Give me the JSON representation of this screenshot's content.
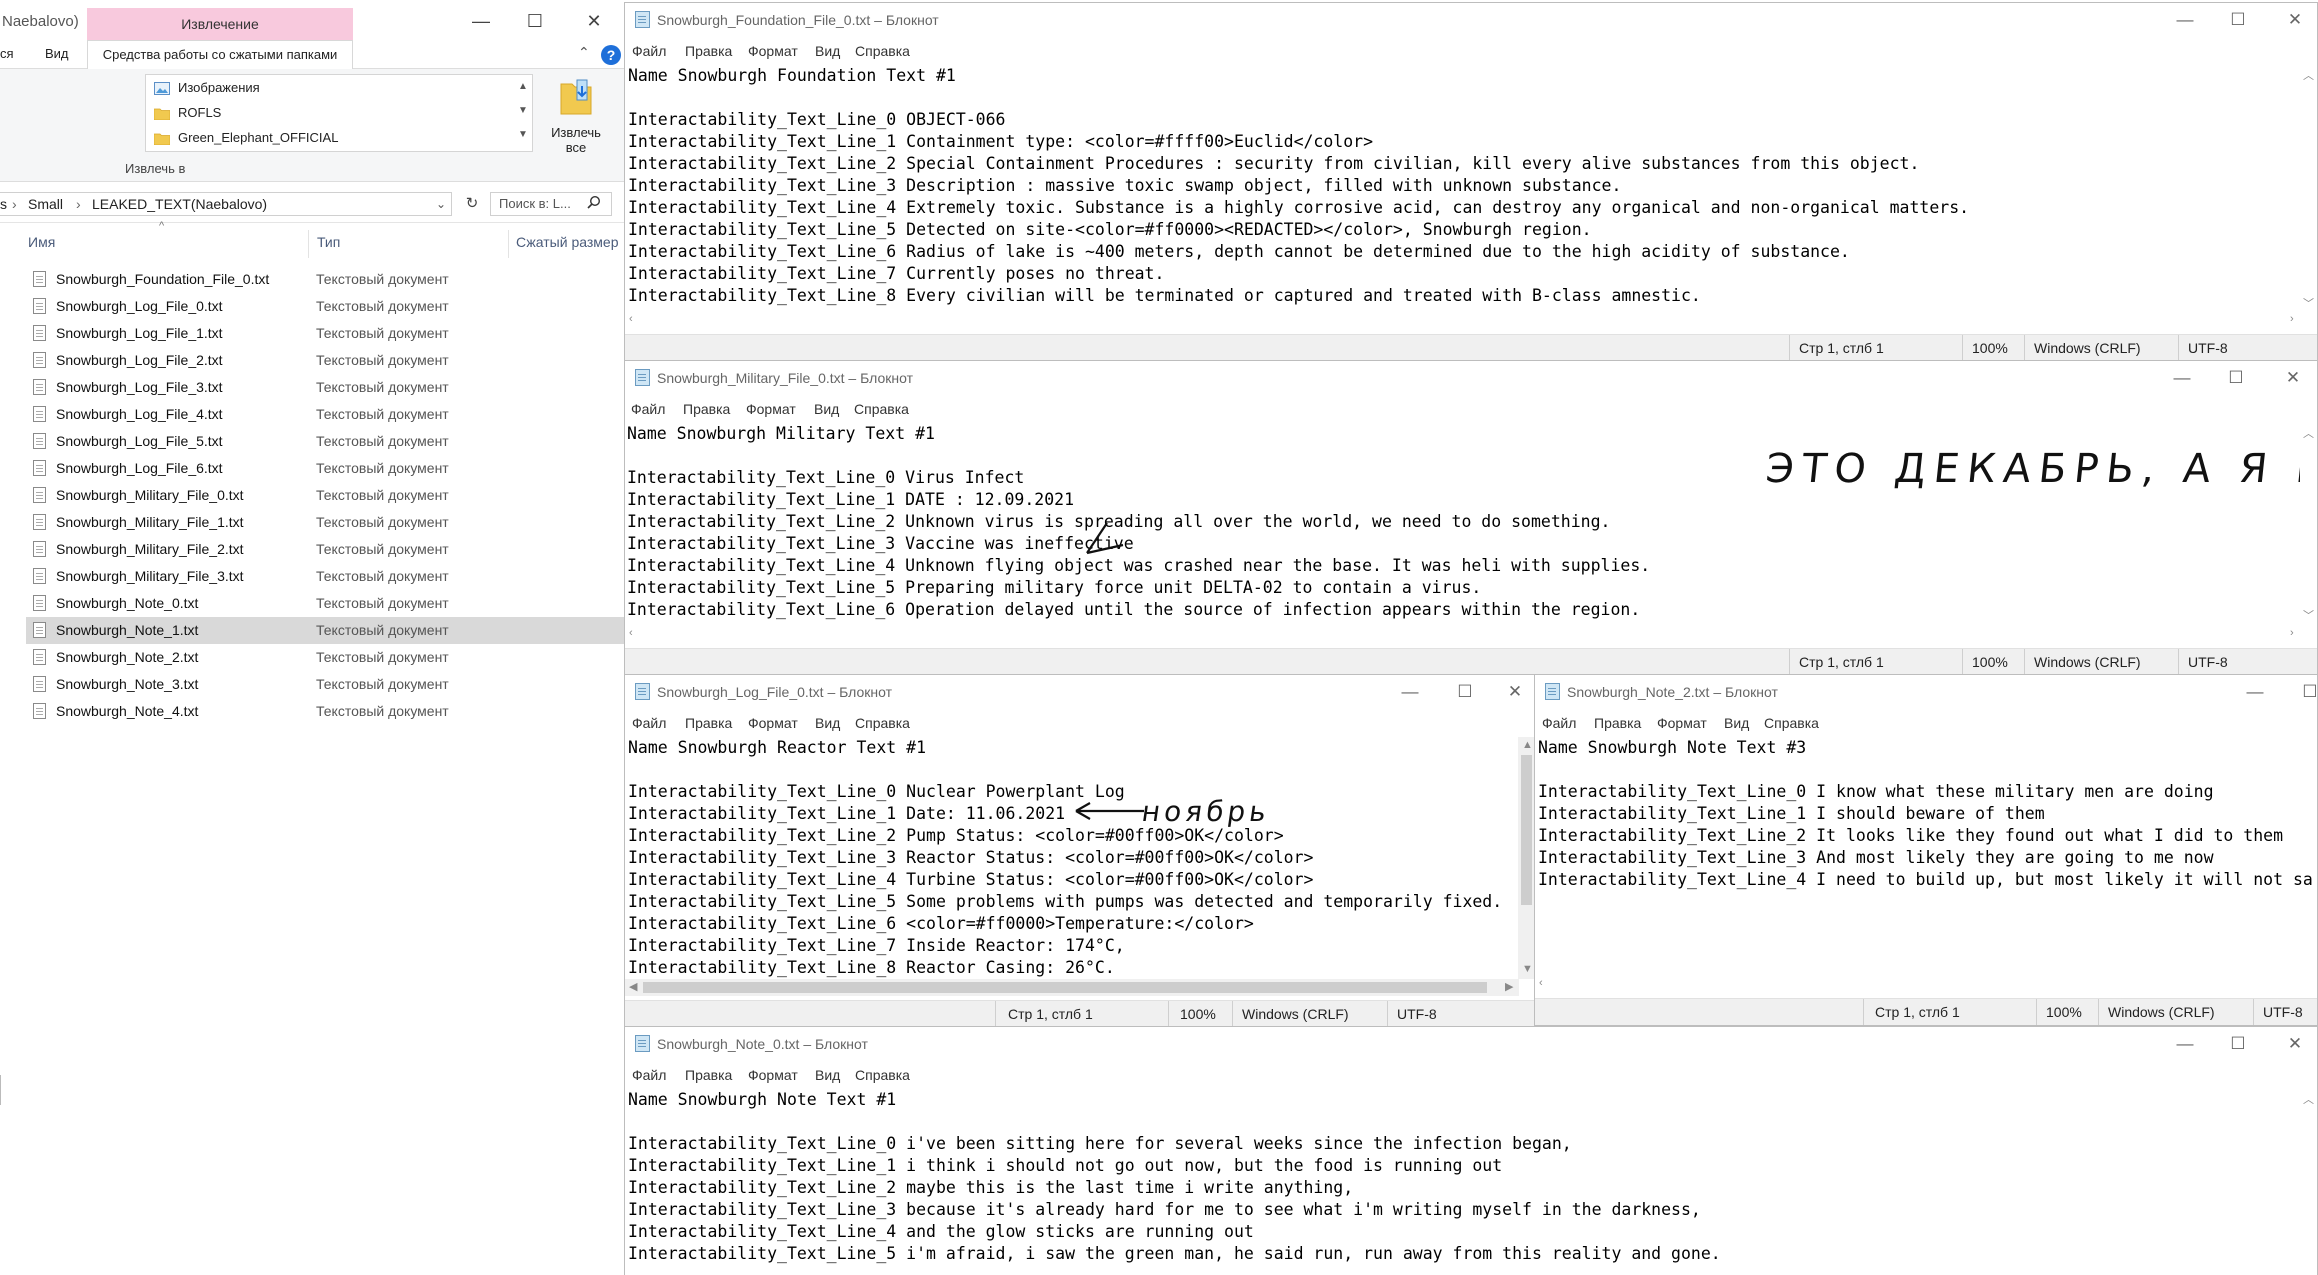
{
  "explorer": {
    "title_fragment": "Naebalovo)",
    "extract_tab": "Извлечение",
    "tabs": [
      "ся",
      "Вид"
    ],
    "active_tab": "Средства работы со сжатыми папками",
    "gallery_items": [
      "Изображения",
      "ROFLS",
      "Green_Elephant_OFFICIAL"
    ],
    "extract_all_label_1": "Извлечь",
    "extract_all_label_2": "все",
    "extract_to_label": "Извлечь в",
    "breadcrumb": [
      "s",
      "Small",
      "LEAKED_TEXT(Naebalovo)"
    ],
    "search_placeholder": "Поиск в: L...",
    "columns": [
      "Имя",
      "Тип",
      "Сжатый размер"
    ],
    "files": [
      {
        "name": "Snowburgh_Foundation_File_0.txt",
        "type": "Текстовый документ"
      },
      {
        "name": "Snowburgh_Log_File_0.txt",
        "type": "Текстовый документ"
      },
      {
        "name": "Snowburgh_Log_File_1.txt",
        "type": "Текстовый документ"
      },
      {
        "name": "Snowburgh_Log_File_2.txt",
        "type": "Текстовый документ"
      },
      {
        "name": "Snowburgh_Log_File_3.txt",
        "type": "Текстовый документ"
      },
      {
        "name": "Snowburgh_Log_File_4.txt",
        "type": "Текстовый документ"
      },
      {
        "name": "Snowburgh_Log_File_5.txt",
        "type": "Текстовый документ"
      },
      {
        "name": "Snowburgh_Log_File_6.txt",
        "type": "Текстовый документ"
      },
      {
        "name": "Snowburgh_Military_File_0.txt",
        "type": "Текстовый документ"
      },
      {
        "name": "Snowburgh_Military_File_1.txt",
        "type": "Текстовый документ"
      },
      {
        "name": "Snowburgh_Military_File_2.txt",
        "type": "Текстовый документ"
      },
      {
        "name": "Snowburgh_Military_File_3.txt",
        "type": "Текстовый документ"
      },
      {
        "name": "Snowburgh_Note_0.txt",
        "type": "Текстовый документ"
      },
      {
        "name": "Snowburgh_Note_1.txt",
        "type": "Текстовый документ",
        "selected": true
      },
      {
        "name": "Snowburgh_Note_2.txt",
        "type": "Текстовый документ"
      },
      {
        "name": "Snowburgh_Note_3.txt",
        "type": "Текстовый документ"
      },
      {
        "name": "Snowburgh_Note_4.txt",
        "type": "Текстовый документ"
      }
    ]
  },
  "notepad_menu": [
    "Файл",
    "Правка",
    "Формат",
    "Вид",
    "Справка"
  ],
  "window_controls": {
    "minimize": "—",
    "maximize": "☐",
    "close": "✕"
  },
  "windows": {
    "foundation": {
      "title": "Snowburgh_Foundation_File_0.txt – Блокнот",
      "lines": [
        "Name Snowburgh Foundation Text #1",
        "",
        "Interactability_Text_Line_0 OBJECT-066",
        "Interactability_Text_Line_1 Containment type: <color=#ffff00>Euclid</color>",
        "Interactability_Text_Line_2 Special Containment Procedures : security from civilian, kill every alive substances from this object.",
        "Interactability_Text_Line_3 Description : massive toxic swamp object, filled with unknown substance.",
        "Interactability_Text_Line_4 Extremely toxic. Substance is a highly corrosive acid, can destroy any organical and non-organical matters.",
        "Interactability_Text_Line_5 Detected on site-<color=#ff0000><REDACTED></color>, Snowburgh region.",
        "Interactability_Text_Line_6 Radius of lake is ~400 meters, depth cannot be determined due to the high acidity of substance.",
        "Interactability_Text_Line_7 Currently poses no threat.",
        "Interactability_Text_Line_8 Every civilian will be terminated or captured and treated with B-class amnestic."
      ],
      "status": {
        "position": "Стр 1, стлб 1",
        "zoom": "100%",
        "eol": "Windows (CRLF)",
        "encoding": "UTF-8"
      }
    },
    "military": {
      "title": "Snowburgh_Military_File_0.txt – Блокнот",
      "lines": [
        "Name Snowburgh Military Text #1",
        "",
        "Interactability_Text_Line_0 Virus Infect",
        "Interactability_Text_Line_1 DATE : 12.09.2021",
        "Interactability_Text_Line_2 Unknown virus is spreading all over the world, we need to do something.",
        "Interactability_Text_Line_3 Vaccine was ineffective",
        "Interactability_Text_Line_4 Unknown flying object was crashed near the base. It was heli with supplies.",
        "Interactability_Text_Line_5 Preparing military force unit DELTA-02 to contain a virus.",
        "Interactability_Text_Line_6 Operation delayed until the source of infection appears within the region."
      ],
      "annotation": "ЭТО ДЕКАБРЬ, А Я ЕБЛАН",
      "status": {
        "position": "Стр 1, стлб 1",
        "zoom": "100%",
        "eol": "Windows (CRLF)",
        "encoding": "UTF-8"
      }
    },
    "log": {
      "title": "Snowburgh_Log_File_0.txt – Блокнот",
      "lines": [
        "Name Snowburgh Reactor Text #1",
        "",
        "Interactability_Text_Line_0 Nuclear Powerplant Log",
        "Interactability_Text_Line_1 Date: 11.06.2021",
        "Interactability_Text_Line_2 Pump Status: <color=#00ff00>OK</color>",
        "Interactability_Text_Line_3 Reactor Status: <color=#00ff00>OK</color>",
        "Interactability_Text_Line_4 Turbine Status: <color=#00ff00>OK</color>",
        "Interactability_Text_Line_5 Some problems with pumps was detected and temporarily fixed.",
        "Interactability_Text_Line_6 <color=#ff0000>Temperature:</color>",
        "Interactability_Text_Line_7 Inside Reactor: 174°C,",
        "Interactability_Text_Line_8 Reactor Casing: 26°C."
      ],
      "annotation": "ноябрь",
      "status": {
        "position": "Стр 1, стлб 1",
        "zoom": "100%",
        "eol": "Windows (CRLF)",
        "encoding": "UTF-8"
      }
    },
    "note2": {
      "title": "Snowburgh_Note_2.txt – Блокнот",
      "lines": [
        "Name Snowburgh Note Text #3",
        "",
        "Interactability_Text_Line_0 I know what these military men are doing",
        "Interactability_Text_Line_1 I should beware of them",
        "Interactability_Text_Line_2 It looks like they found out what I did to them",
        "Interactability_Text_Line_3 And most likely they are going to me now",
        "Interactability_Text_Line_4 I need to build up, but most likely it will not sa"
      ],
      "status": {
        "position": "Стр 1, стлб 1",
        "zoom": "100%",
        "eol": "Windows (CRLF)",
        "encoding": "UTF-8"
      }
    },
    "note0": {
      "title": "Snowburgh_Note_0.txt – Блокнот",
      "lines": [
        "Name Snowburgh Note Text #1",
        "",
        "Interactability_Text_Line_0 i've been sitting here for several weeks since the infection began,",
        "Interactability_Text_Line_1 i think i should not go out now, but the food is running out",
        "Interactability_Text_Line_2 maybe this is the last time i write anything,",
        "Interactability_Text_Line_3 because it's already hard for me to see what i'm writing myself in the darkness,",
        "Interactability_Text_Line_4 and the glow sticks are running out",
        "Interactability_Text_Line_5 i'm afraid, i saw the green man, he said run, run away from this reality and gone."
      ]
    }
  }
}
